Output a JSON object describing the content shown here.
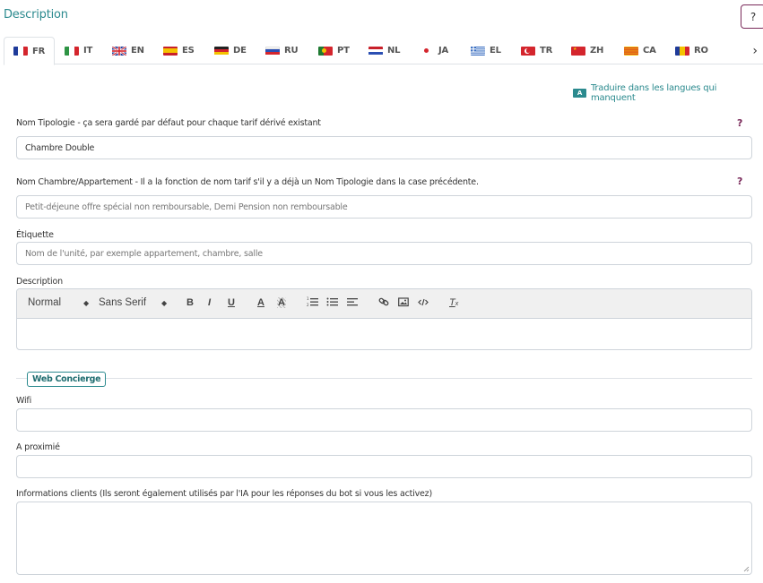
{
  "header": {
    "title": "Description",
    "help_label": "?"
  },
  "tabs": [
    {
      "code": "FR",
      "flag": "france-flag-icon",
      "active": true
    },
    {
      "code": "IT",
      "flag": "italy-flag-icon"
    },
    {
      "code": "EN",
      "flag": "uk-flag-icon"
    },
    {
      "code": "ES",
      "flag": "spain-flag-icon"
    },
    {
      "code": "DE",
      "flag": "germany-flag-icon"
    },
    {
      "code": "RU",
      "flag": "russia-flag-icon"
    },
    {
      "code": "PT",
      "flag": "portugal-flag-icon"
    },
    {
      "code": "NL",
      "flag": "netherlands-flag-icon"
    },
    {
      "code": "JA",
      "flag": "japan-flag-icon"
    },
    {
      "code": "EL",
      "flag": "greece-flag-icon"
    },
    {
      "code": "TR",
      "flag": "turkey-flag-icon"
    },
    {
      "code": "ZH",
      "flag": "china-flag-icon"
    },
    {
      "code": "CA",
      "flag": "catalonia-flag-icon"
    },
    {
      "code": "RO",
      "flag": "romania-flag-icon"
    }
  ],
  "tabs_next_icon": "chevron-right-icon",
  "translate": {
    "label": "Traduire dans les langues qui manquent",
    "icon": "translate-icon"
  },
  "fields": {
    "typology": {
      "label": "Nom Tipologie - ça sera gardé par défaut pour chaque tarif dérivé existant",
      "value": "Chambre Double",
      "help": "?"
    },
    "room_name": {
      "label": "Nom Chambre/Appartement - Il a la fonction de nom tarif s'il y a déjà un Nom Tipologie dans la case précédente.",
      "placeholder": "Petit-déjeune offre spécial non remboursable, Demi Pension non remboursable",
      "help": "?"
    },
    "tag": {
      "label": "Étiquette",
      "placeholder": "Nom de l'unité, par exemple appartement, chambre, salle"
    },
    "description": {
      "label": "Description"
    }
  },
  "editor_toolbar": {
    "heading": "Normal",
    "font": "Sans Serif",
    "bold": "B",
    "italic": "I",
    "underline": "U",
    "text_color": "A",
    "background_color": "A",
    "clean": "T"
  },
  "section": {
    "label": "Web Concierge"
  },
  "concierge": {
    "wifi": {
      "label": "Wifi",
      "value": ""
    },
    "nearby": {
      "label": "A proximié",
      "value": ""
    },
    "client_info": {
      "label": "Informations clients (Ils seront également utilisés par l'IA pour les réponses du bot si vous les activez)",
      "value": ""
    }
  },
  "colors": {
    "accent": "#2b8a8e",
    "help": "#7a2a5a",
    "border": "#ced4da"
  }
}
